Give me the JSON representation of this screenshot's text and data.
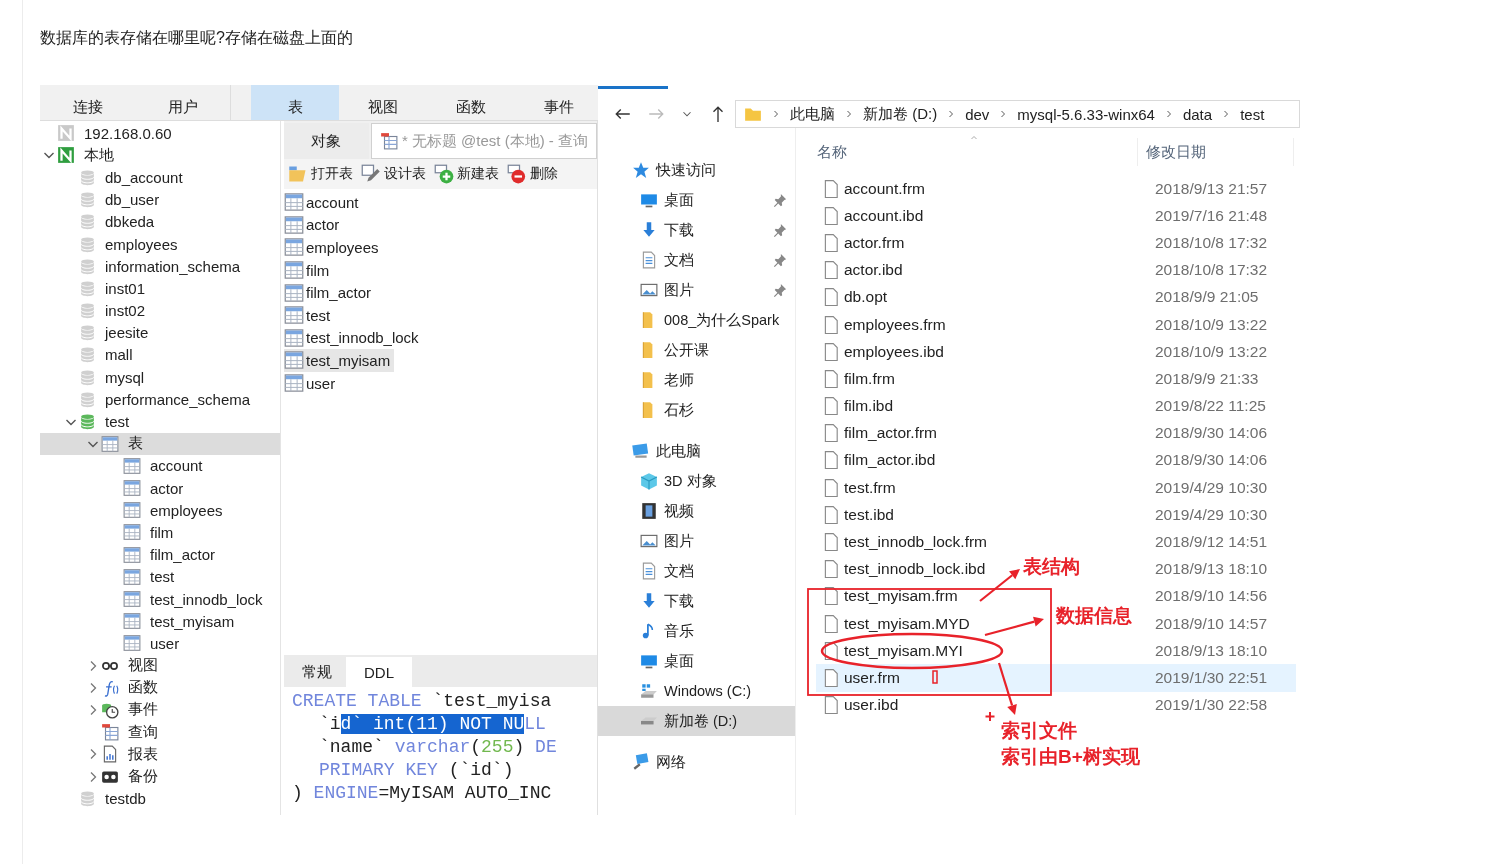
{
  "heading": "数据库的表存储在哪里呢?存储在磁盘上面的",
  "navicat": {
    "toolbar": [
      {
        "label": "连接",
        "kind": "connection",
        "selected": false
      },
      {
        "label": "用户",
        "kind": "connection",
        "selected": false
      },
      {
        "label": "表",
        "kind": "object",
        "selected": true
      },
      {
        "label": "视图",
        "kind": "object",
        "selected": false
      },
      {
        "label": "函数",
        "kind": "object",
        "selected": false
      },
      {
        "label": "事件",
        "kind": "object",
        "selected": false
      }
    ],
    "tree": [
      {
        "label": "192.168.0.60",
        "kind": "connection",
        "connected": false,
        "selected": false
      },
      {
        "label": "本地",
        "kind": "connection",
        "connected": true,
        "expanded": true,
        "selected": false,
        "children": [
          {
            "label": "db_account",
            "kind": "database",
            "open": false,
            "selected": false
          },
          {
            "label": "db_user",
            "kind": "database",
            "open": false,
            "selected": false
          },
          {
            "label": "dbkeda",
            "kind": "database",
            "open": false,
            "selected": false
          },
          {
            "label": "employees",
            "kind": "database",
            "open": false,
            "selected": false
          },
          {
            "label": "information_schema",
            "kind": "database",
            "open": false,
            "selected": false
          },
          {
            "label": "inst01",
            "kind": "database",
            "open": false,
            "selected": false
          },
          {
            "label": "inst02",
            "kind": "database",
            "open": false,
            "selected": false
          },
          {
            "label": "jeesite",
            "kind": "database",
            "open": false,
            "selected": false
          },
          {
            "label": "mall",
            "kind": "database",
            "open": false,
            "selected": false
          },
          {
            "label": "mysql",
            "kind": "database",
            "open": false,
            "selected": false
          },
          {
            "label": "performance_schema",
            "kind": "database",
            "open": false,
            "selected": false
          },
          {
            "label": "test",
            "kind": "database",
            "open": true,
            "expanded": true,
            "selected": false,
            "children": [
              {
                "label": "表",
                "kind": "tables",
                "expanded": true,
                "selected": true,
                "children": [
                  {
                    "label": "account",
                    "kind": "table",
                    "selected": false
                  },
                  {
                    "label": "actor",
                    "kind": "table",
                    "selected": false
                  },
                  {
                    "label": "employees",
                    "kind": "table",
                    "selected": false
                  },
                  {
                    "label": "film",
                    "kind": "table",
                    "selected": false
                  },
                  {
                    "label": "film_actor",
                    "kind": "table",
                    "selected": false
                  },
                  {
                    "label": "test",
                    "kind": "table",
                    "selected": false
                  },
                  {
                    "label": "test_innodb_lock",
                    "kind": "table",
                    "selected": false
                  },
                  {
                    "label": "test_myisam",
                    "kind": "table",
                    "selected": false
                  },
                  {
                    "label": "user",
                    "kind": "table",
                    "selected": false
                  }
                ]
              },
              {
                "label": "视图",
                "kind": "views",
                "expanded": false,
                "selected": false
              },
              {
                "label": "函数",
                "kind": "functions",
                "expanded": false,
                "selected": false
              },
              {
                "label": "事件",
                "kind": "events",
                "expanded": false,
                "selected": false
              },
              {
                "label": "查询",
                "kind": "queries",
                "selected": false
              },
              {
                "label": "报表",
                "kind": "reports",
                "expanded": false,
                "selected": false
              },
              {
                "label": "备份",
                "kind": "backups",
                "expanded": false,
                "selected": false
              }
            ]
          },
          {
            "label": "testdb",
            "kind": "database",
            "open": false,
            "selected": false
          }
        ]
      }
    ],
    "tabs": [
      {
        "label": "对象",
        "kind": "objects",
        "selected": false
      },
      {
        "label": "* 无标题 @test (本地) - 查询",
        "kind": "query",
        "selected": true
      }
    ],
    "actions": [
      {
        "label": "打开表",
        "kind": "open"
      },
      {
        "label": "设计表",
        "kind": "design"
      },
      {
        "label": "新建表",
        "kind": "new"
      },
      {
        "label": "删除",
        "kind": "delete"
      }
    ],
    "objects": [
      {
        "label": "account",
        "selected": false
      },
      {
        "label": "actor",
        "selected": false
      },
      {
        "label": "employees",
        "selected": false
      },
      {
        "label": "film",
        "selected": false
      },
      {
        "label": "film_actor",
        "selected": false
      },
      {
        "label": "test",
        "selected": false
      },
      {
        "label": "test_innodb_lock",
        "selected": false
      },
      {
        "label": "test_myisam",
        "selected": true
      },
      {
        "label": "user",
        "selected": false
      }
    ],
    "info_tabs": [
      {
        "label": "常规",
        "selected": false
      },
      {
        "label": "DDL",
        "selected": true
      }
    ],
    "ddl": [
      {
        "kind": "statement",
        "tokens": [
          {
            "kind": "keyword",
            "text": "CREATE TABLE"
          },
          {
            "kind": "plain",
            "text": " `test_myisa"
          }
        ]
      },
      {
        "kind": "column",
        "tokens": [
          {
            "kind": "plain",
            "text": "`i"
          },
          {
            "kind": "selected",
            "text": "d` int(11) NOT NU"
          },
          {
            "kind": "keyword",
            "text": "LL"
          }
        ]
      },
      {
        "kind": "column",
        "tokens": [
          {
            "kind": "plain",
            "text": "`name` "
          },
          {
            "kind": "keyword",
            "text": "varchar"
          },
          {
            "kind": "plain",
            "text": "("
          },
          {
            "kind": "number",
            "text": "255"
          },
          {
            "kind": "plain",
            "text": ") "
          },
          {
            "kind": "keyword",
            "text": "DE"
          }
        ]
      },
      {
        "kind": "column",
        "tokens": [
          {
            "kind": "keyword",
            "text": "PRIMARY KEY"
          },
          {
            "kind": "plain",
            "text": " (`id`)"
          }
        ]
      },
      {
        "kind": "statement",
        "tokens": [
          {
            "kind": "plain",
            "text": ") "
          },
          {
            "kind": "keyword",
            "text": "ENGINE"
          },
          {
            "kind": "plain",
            "text": "=MyISAM AUTO_INC"
          }
        ]
      }
    ]
  },
  "explorer": {
    "breadcrumb": [
      "此电脑",
      "新加卷 (D:)",
      "dev",
      "mysql-5.6.33-winx64",
      "data",
      "test"
    ],
    "nav": [
      {
        "label": "快速访问",
        "kind": "star",
        "selected": false,
        "children": [
          {
            "label": "桌面",
            "kind": "desktop",
            "pinned": true,
            "selected": false
          },
          {
            "label": "下载",
            "kind": "download",
            "pinned": true,
            "selected": false
          },
          {
            "label": "文档",
            "kind": "document",
            "pinned": true,
            "selected": false
          },
          {
            "label": "图片",
            "kind": "picture",
            "pinned": true,
            "selected": false
          },
          {
            "label": "008_为什么Spark",
            "kind": "folder",
            "pinned": false,
            "selected": false
          },
          {
            "label": "公开课",
            "kind": "folder",
            "pinned": false,
            "selected": false
          },
          {
            "label": "老师",
            "kind": "folder",
            "pinned": false,
            "selected": false
          },
          {
            "label": "石杉",
            "kind": "folder",
            "pinned": false,
            "selected": false
          }
        ]
      },
      {
        "label": "此电脑",
        "kind": "pc",
        "selected": false,
        "children": [
          {
            "label": "3D 对象",
            "kind": "cube",
            "selected": false
          },
          {
            "label": "视频",
            "kind": "video",
            "selected": false
          },
          {
            "label": "图片",
            "kind": "picture",
            "selected": false
          },
          {
            "label": "文档",
            "kind": "document",
            "selected": false
          },
          {
            "label": "下载",
            "kind": "download",
            "selected": false
          },
          {
            "label": "音乐",
            "kind": "music",
            "selected": false
          },
          {
            "label": "桌面",
            "kind": "desktop",
            "selected": false
          },
          {
            "label": "Windows (C:)",
            "kind": "windrive",
            "selected": false
          },
          {
            "label": "新加卷 (D:)",
            "kind": "drive",
            "selected": true
          }
        ]
      },
      {
        "label": "网络",
        "kind": "network",
        "selected": false
      }
    ],
    "columns": [
      "名称",
      "修改日期"
    ],
    "files": [
      {
        "name": "account.frm",
        "date": "2018/9/13 21:57",
        "selected": false
      },
      {
        "name": "account.ibd",
        "date": "2019/7/16 21:48",
        "selected": false
      },
      {
        "name": "actor.frm",
        "date": "2018/10/8 17:32",
        "selected": false
      },
      {
        "name": "actor.ibd",
        "date": "2018/10/8 17:32",
        "selected": false
      },
      {
        "name": "db.opt",
        "date": "2018/9/9 21:05",
        "selected": false
      },
      {
        "name": "employees.frm",
        "date": "2018/10/9 13:22",
        "selected": false
      },
      {
        "name": "employees.ibd",
        "date": "2018/10/9 13:22",
        "selected": false
      },
      {
        "name": "film.frm",
        "date": "2018/9/9 21:33",
        "selected": false
      },
      {
        "name": "film.ibd",
        "date": "2019/8/22 11:25",
        "selected": false
      },
      {
        "name": "film_actor.frm",
        "date": "2018/9/30 14:06",
        "selected": false
      },
      {
        "name": "film_actor.ibd",
        "date": "2018/9/30 14:06",
        "selected": false
      },
      {
        "name": "test.frm",
        "date": "2019/4/29 10:30",
        "selected": false
      },
      {
        "name": "test.ibd",
        "date": "2019/4/29 10:30",
        "selected": false
      },
      {
        "name": "test_innodb_lock.frm",
        "date": "2018/9/12 14:51",
        "selected": false
      },
      {
        "name": "test_innodb_lock.ibd",
        "date": "2018/9/13 18:10",
        "selected": false
      },
      {
        "name": "test_myisam.frm",
        "date": "2018/9/10 14:56",
        "selected": false
      },
      {
        "name": "test_myisam.MYD",
        "date": "2018/9/10 14:57",
        "selected": false
      },
      {
        "name": "test_myisam.MYI",
        "date": "2018/9/13 18:10",
        "selected": false
      },
      {
        "name": "user.frm",
        "date": "2019/1/30 22:51",
        "selected": true
      },
      {
        "name": "user.ibd",
        "date": "2019/1/30 22:58",
        "selected": false
      }
    ],
    "annotations": [
      "表结构",
      "数据信息",
      "索引文件",
      "索引由B+树实现"
    ]
  }
}
